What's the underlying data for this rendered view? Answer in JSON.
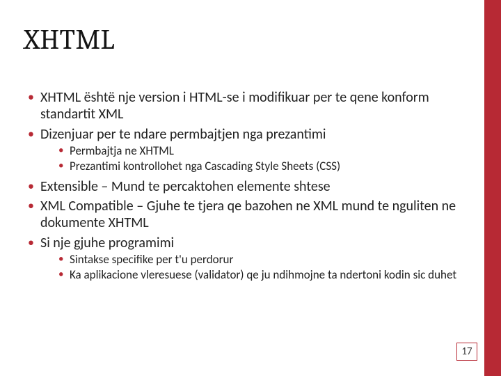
{
  "title": "XHTML",
  "bullets": {
    "b1": "XHTML është nje version i HTML-se i modifikuar per te qene konform standartit XML",
    "b2": "Dizenjuar per te ndare permbajtjen nga prezantimi",
    "b2_sub1": "Permbajtja ne XHTML",
    "b2_sub2": "Prezantimi kontrollohet nga Cascading Style Sheets (CSS)",
    "b3": "Extensible – Mund te percaktohen elemente shtese",
    "b4": "XML Compatible – Gjuhe te tjera qe bazohen ne XML mund te nguliten ne dokumente XHTML",
    "b5": "Si nje gjuhe programimi",
    "b5_sub1": "Sintakse specifike per t'u perdorur",
    "b5_sub2": "Ka aplikacione vleresuese (validator) qe ju ndihmojne ta ndertoni kodin sic duhet"
  },
  "page_number": "17",
  "colors": {
    "accent": "#b72934"
  }
}
